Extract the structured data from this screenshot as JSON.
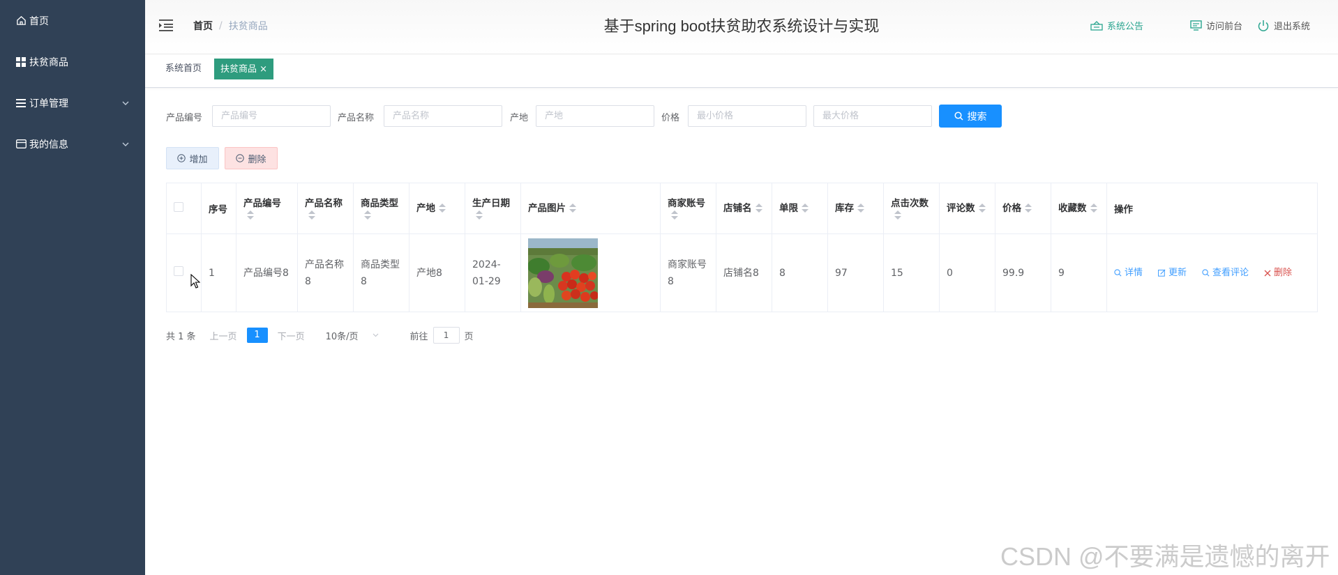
{
  "sidebar": {
    "items": [
      {
        "label": "首页",
        "icon": "home-icon",
        "expandable": false
      },
      {
        "label": "扶贫商品",
        "icon": "grid-icon",
        "expandable": false
      },
      {
        "label": "订单管理",
        "icon": "list-icon",
        "expandable": true
      },
      {
        "label": "我的信息",
        "icon": "card-icon",
        "expandable": true
      }
    ]
  },
  "header": {
    "breadcrumb_home": "首页",
    "breadcrumb_sep": "/",
    "breadcrumb_current": "扶贫商品",
    "title": "基于spring boot扶贫助农系统设计与实现",
    "notice": "系统公告",
    "front": "访问前台",
    "logout": "退出系统"
  },
  "tags": {
    "home": "系统首页",
    "active": "扶贫商品",
    "close": "×"
  },
  "search": {
    "code_label": "产品编号",
    "code_placeholder": "产品编号",
    "name_label": "产品名称",
    "name_placeholder": "产品名称",
    "origin_label": "产地",
    "origin_placeholder": "产地",
    "price_label": "价格",
    "min_placeholder": "最小价格",
    "max_placeholder": "最大价格",
    "button": "搜索"
  },
  "actions": {
    "add": "增加",
    "delete": "删除"
  },
  "table": {
    "headers": [
      "序号",
      "产品编号",
      "产品名称",
      "商品类型",
      "产地",
      "生产日期",
      "产品图片",
      "商家账号",
      "店铺名",
      "单限",
      "库存",
      "点击次数",
      "评论数",
      "价格",
      "收藏数",
      "操作"
    ],
    "rows": [
      {
        "index": "1",
        "code": "产品编号8",
        "name": "产品名称8",
        "type": "商品类型8",
        "origin": "产地8",
        "date": "2024-01-29",
        "merchant": "商家账号8",
        "shop": "店铺名8",
        "limit": "8",
        "stock": "97",
        "clicks": "15",
        "comments": "0",
        "price": "99.9",
        "favorites": "9",
        "ops": {
          "detail": "详情",
          "update": "更新",
          "reviews": "查看评论",
          "delete": "删除"
        }
      }
    ]
  },
  "pagination": {
    "total": "共 1 条",
    "prev": "上一页",
    "current": "1",
    "next": "下一页",
    "page_size": "10条/页",
    "goto_prefix": "前往",
    "goto_value": "1",
    "goto_suffix": "页"
  },
  "watermark": "CSDN @不要满是遗憾的离开",
  "colors": {
    "sidebar_bg": "#304156",
    "accent_green": "#2e9c7e",
    "primary_blue": "#1890ff",
    "danger_red": "#d9534f"
  }
}
